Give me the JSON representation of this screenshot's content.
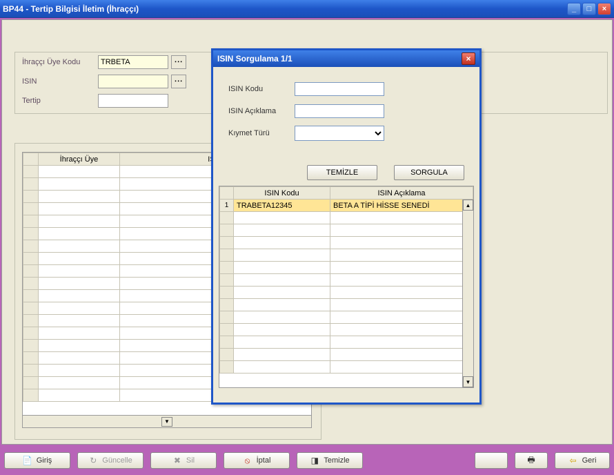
{
  "window": {
    "title": "BP44 - Tertip Bilgisi İletim (İhraççı)"
  },
  "form": {
    "ihracci_uye_kodu_label": "İhraççı Üye Kodu",
    "ihracci_uye_kodu_value": "TRBETA",
    "isin_label": "ISIN",
    "isin_value": "",
    "tertip_label": "Tertip",
    "tertip_value": ""
  },
  "main_grid": {
    "columns": [
      "İhraççı Üye",
      "ISIN"
    ]
  },
  "toolbar": {
    "giris": "Giriş",
    "guncelle": "Güncelle",
    "sil": "Sil",
    "iptal": "İptal",
    "temizle": "Temizle",
    "geri": "Geri"
  },
  "dialog": {
    "title": "ISIN Sorgulama 1/1",
    "isin_kodu_label": "ISIN Kodu",
    "isin_kodu_value": "",
    "isin_aciklama_label": "ISIN Açıklama",
    "isin_aciklama_value": "",
    "kiymet_turu_label": "Kıymet Türü",
    "temizle_btn": "TEMİZLE",
    "sorgula_btn": "SORGULA",
    "grid": {
      "columns": [
        "ISIN Kodu",
        "ISIN Açıklama"
      ],
      "rows": [
        {
          "no": "1",
          "isin": "TRABETA12345",
          "aciklama": "BETA A TİPİ HİSSE SENEDİ"
        }
      ]
    }
  },
  "icons": {
    "ellipsis": "∙∙∙",
    "giris": "📄",
    "guncelle": "↻",
    "sil": "✖",
    "iptal": "⦸",
    "temizle": "◨",
    "print": "🖶",
    "geri": "⇦"
  }
}
